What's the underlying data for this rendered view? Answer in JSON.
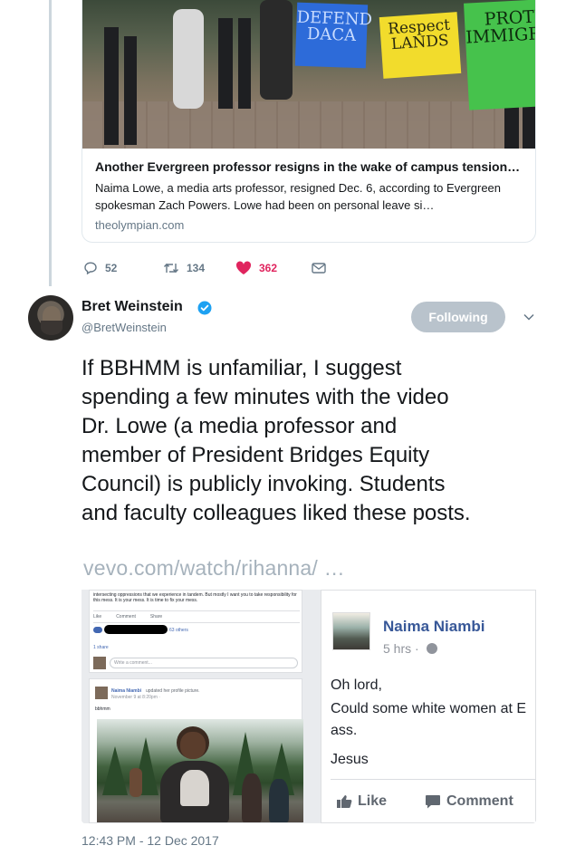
{
  "link_card": {
    "photo_signs": [
      "DEFEND DACA",
      "Respect LANDS",
      "PROTECT IMMIGRANTS"
    ],
    "title": "Another Evergreen professor resigns in the wake of campus tension…",
    "description": "Naima Lowe, a media arts professor, resigned Dec. 6, according to Evergreen spokesman Zach Powers. Lowe had been on personal leave si…",
    "domain": "theolympian.com"
  },
  "previous_tweet_actions": {
    "reply_count": "52",
    "retweet_count": "134",
    "like_count": "362"
  },
  "tweet": {
    "author_name": "Bret Weinstein",
    "author_handle": "@BretWeinstein",
    "follow_label": "Following",
    "text_lines": [
      "If BBHMM is unfamiliar, I suggest",
      "spending a few minutes with the video",
      "Dr. Lowe (a media professor and",
      "member of President Bridges Equity",
      "Council) is publicly invoking. Students",
      "and faculty colleagues liked these posts."
    ],
    "link_text": "vevo.com/watch/rihanna/  …",
    "timestamp": "12:43 PM - 12 Dec 2017"
  },
  "media_left": {
    "top_text": "intersecting oppressions that we experience in tandem. But mostly I want you to take responsibility for this mess. It is your mess. It is time to fix your mess.",
    "actions": [
      "Like",
      "Comment",
      "Share"
    ],
    "others": "63 others",
    "shares": "1 share",
    "comment_placeholder": "Write a comment...",
    "post_name": "Naima Niambi",
    "post_action": "updated her profile picture.",
    "post_time": "November 9 at 8:20pm ·",
    "post_text": "bbhmm"
  },
  "media_right": {
    "name": "Naima Niambi",
    "time": "5 hrs ·",
    "lines": [
      "Oh lord,",
      "Could some white women at E",
      "ass.",
      "Jesus"
    ],
    "like_label": "Like",
    "comment_label": "Comment"
  },
  "colors": {
    "like_accent": "#e0245e",
    "verified_blue": "#1da1f2",
    "follow_button": "#b9c3cc",
    "facebook_blue": "#385898"
  }
}
